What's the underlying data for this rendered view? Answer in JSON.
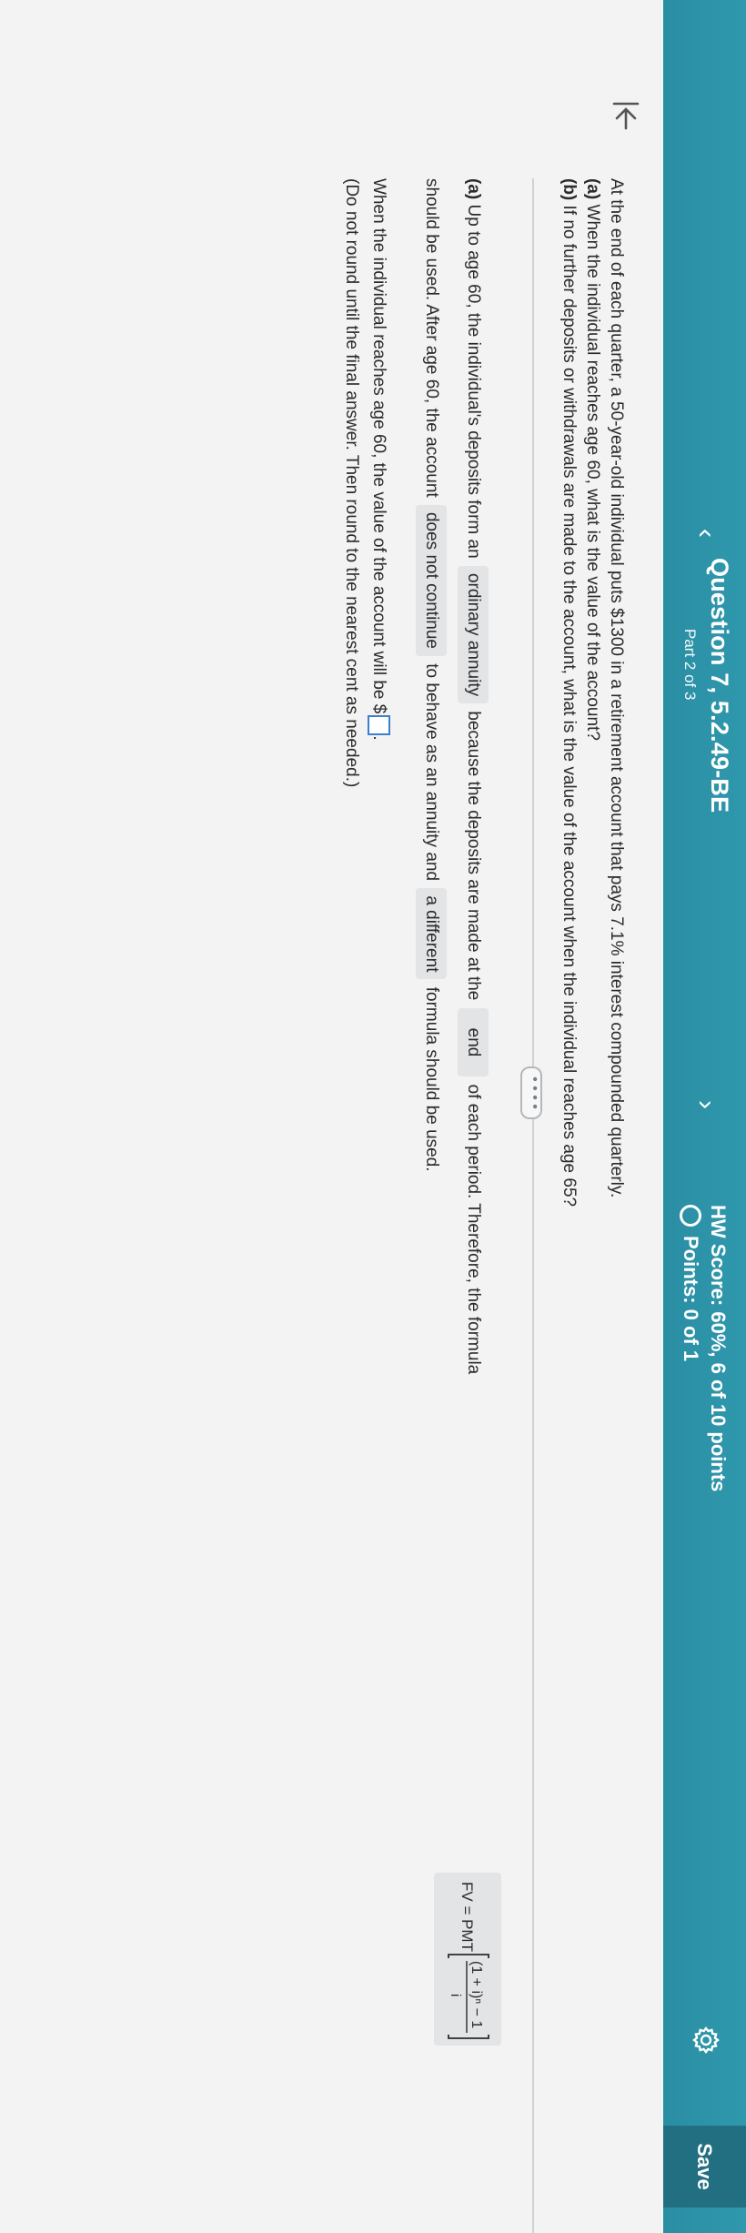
{
  "header": {
    "question_title": "Question 7, 5.2.49-BE",
    "part": "Part 2 of 3",
    "hw_score": "HW Score: 60%, 6 of 10 points",
    "points": "Points: 0 of 1",
    "save_label": "Save",
    "prev_glyph": "‹",
    "next_glyph": "›",
    "brand_color": "#2f98ad"
  },
  "problem": {
    "intro": "At the end of each quarter, a 50-year-old individual puts $1300 in a retirement account that pays 7.1% interest compounded quarterly.",
    "a_label": "(a)",
    "a_text": "When the individual reaches age 60, what is the value of the account?",
    "b_label": "(b)",
    "b_text": "If no further deposits or withdrawals are made to the account, what is the value of the account when the individual reaches age 65?"
  },
  "expand_label": "• • • •",
  "answer": {
    "a_label": "(a)",
    "text1": "Up to age 60, the individual's deposits form an",
    "choice_annuity": "ordinary annuity",
    "text2": "because the deposits are made at the",
    "choice_timing": "end",
    "text3": "of each period. Therefore, the formula",
    "formula_prefix": "FV = PMT",
    "formula_numerator": "(1 + i)ⁿ − 1",
    "formula_denominator": "i",
    "text4": "should be used. After age 60, the account",
    "choice_continue": "does not continue",
    "text5": "to behave as an annuity and",
    "choice_formula": "a different",
    "text6": "formula should be used.",
    "result_text": "When the individual reaches age 60, the value of the account will be $",
    "result_end": ".",
    "instruction": "(Do not round until the final answer. Then round to the nearest cent as needed.)"
  },
  "icons": {
    "back": "back-to-start-icon",
    "settings": "gear-icon",
    "points_status": "circle-icon"
  }
}
